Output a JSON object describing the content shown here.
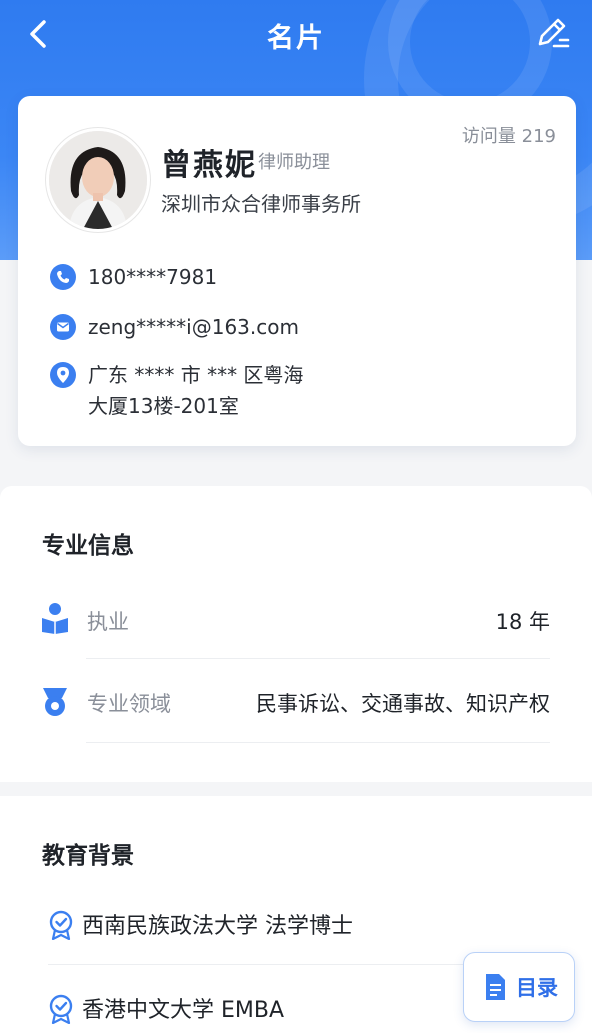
{
  "header": {
    "title": "名片"
  },
  "card": {
    "visits": "访问量 219",
    "name": "曾燕妮",
    "role": "律师助理",
    "firm": "深圳市众合律师事务所",
    "phone": "180****7981",
    "email": "zeng*****i@163.com",
    "address_line1": "广东 **** 市 *** 区粤海",
    "address_line2": "大厦13楼-201室"
  },
  "professional": {
    "title": "专业信息",
    "practice_label": "执业",
    "practice_value": "18 年",
    "field_label": "专业领域",
    "field_value": "民事诉讼、交通事故、知识产权"
  },
  "education": {
    "title": "教育背景",
    "items": [
      "西南民族政法大学 法学博士",
      "香港中文大学 EMBA"
    ]
  },
  "toc_button": {
    "label": "目录"
  },
  "colors": {
    "accent": "#2f7bf0",
    "icon_blue": "#3b7ff0"
  },
  "icons": [
    "back-arrow-icon",
    "edit-pen-icon",
    "phone-icon",
    "email-icon",
    "location-pin-icon",
    "practice-book-icon",
    "medal-icon",
    "badge-check-icon",
    "document-icon"
  ]
}
